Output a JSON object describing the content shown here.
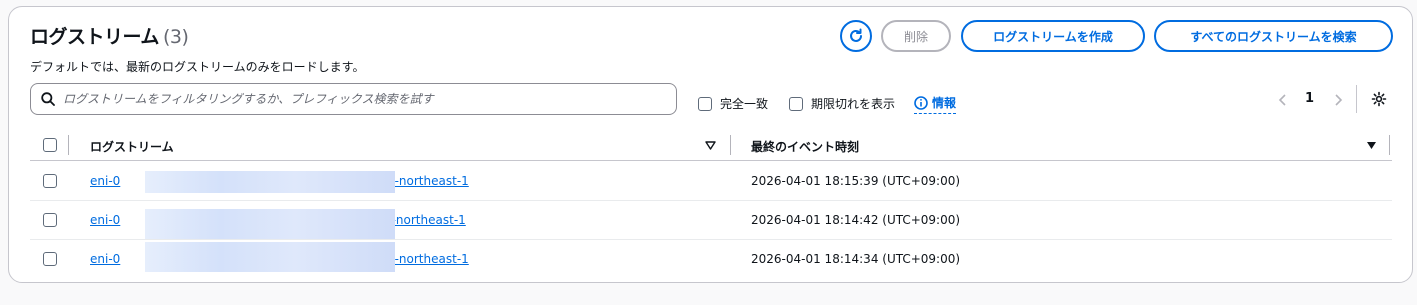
{
  "header": {
    "title": "ログストリーム",
    "count": "(3)",
    "description": "デフォルトでは、最新のログストリームのみをロードします。",
    "refresh_icon": "refresh-icon",
    "delete_label": "削除",
    "create_label": "ログストリームを作成",
    "search_all_label": "すべてのログストリームを検索"
  },
  "search": {
    "placeholder": "ログストリームをフィルタリングするか、プレフィックス検索を試す",
    "value": ""
  },
  "filters": {
    "exact_match_label": "完全一致",
    "show_expired_label": "期限切れを表示",
    "info_label": "情報"
  },
  "pagination": {
    "current_page": "1",
    "prev_icon": "chevron-left-icon",
    "next_icon": "chevron-right-icon",
    "settings_icon": "gear-icon"
  },
  "table": {
    "columns": [
      "ログストリーム",
      "最終のイベント時刻"
    ],
    "rows": [
      {
        "stream_prefix": "eni-0",
        "stream_suffix": "-ap-northeast-1",
        "last_event": "2026-04-01 18:15:39 (UTC+09:00)"
      },
      {
        "stream_prefix": "eni-0",
        "stream_suffix": "-ap-northeast-1",
        "last_event": "2026-04-01 18:14:42 (UTC+09:00)"
      },
      {
        "stream_prefix": "eni-0",
        "stream_suffix": "-ap-northeast-1",
        "last_event": "2026-04-01 18:14:34 (UTC+09:00)"
      }
    ]
  },
  "colors": {
    "accent": "#006ce0",
    "border": "#c6c6cd",
    "disabled": "#8c8c94"
  }
}
